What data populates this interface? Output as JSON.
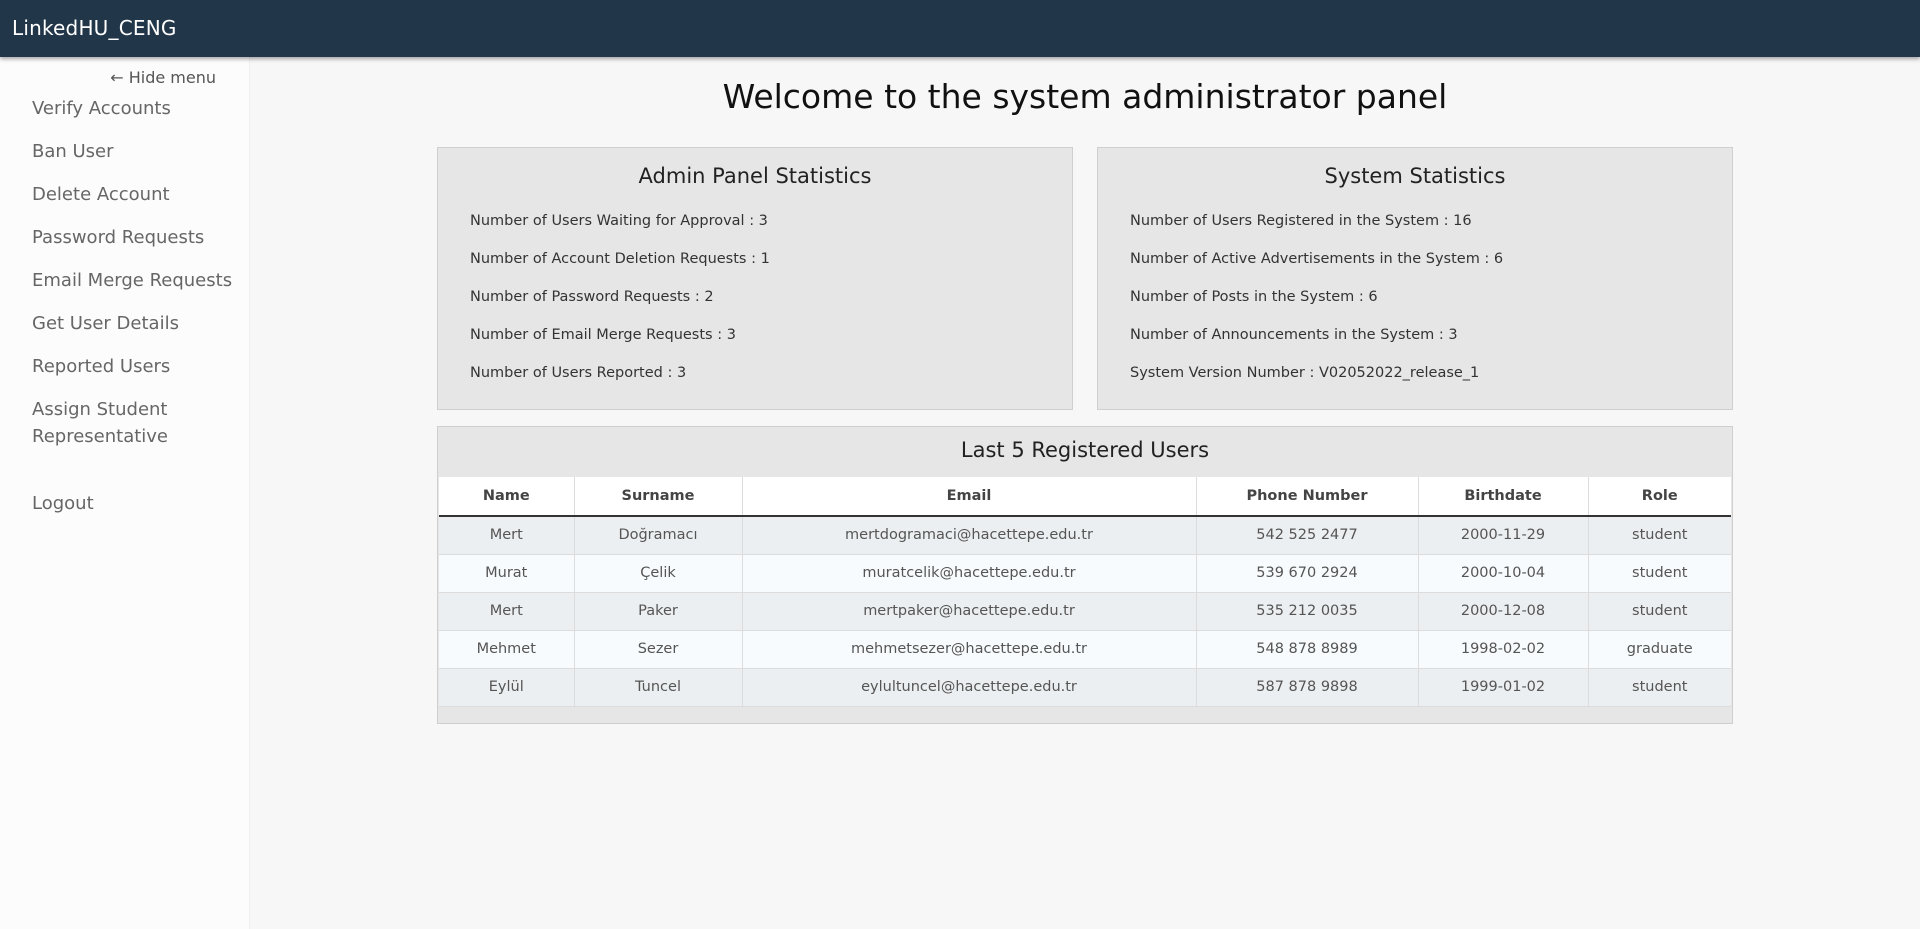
{
  "app": {
    "title": "LinkedHU_CENG"
  },
  "sidebar": {
    "hide_menu_label": "← Hide menu",
    "items": [
      {
        "label": "Verify Accounts"
      },
      {
        "label": "Ban User"
      },
      {
        "label": "Delete Account"
      },
      {
        "label": "Password Requests"
      },
      {
        "label": "Email Merge Requests"
      },
      {
        "label": "Get User Details"
      },
      {
        "label": "Reported Users"
      },
      {
        "label": "Assign Student Representative"
      }
    ],
    "logout_label": "Logout"
  },
  "main": {
    "welcome": "Welcome to the system administrator panel",
    "admin_stats": {
      "title": "Admin Panel Statistics",
      "lines": [
        "Number of Users Waiting for Approval : 3",
        "Number of Account Deletion Requests : 1",
        "Number of Password Requests : 2",
        "Number of Email Merge Requests : 3",
        "Number of Users Reported : 3"
      ]
    },
    "system_stats": {
      "title": "System Statistics",
      "lines": [
        "Number of Users Registered in the System : 16",
        "Number of Active Advertisements in the System : 6",
        "Number of Posts in the System : 6",
        "Number of Announcements in the System : 3",
        "System Version Number : V02052022_release_1"
      ]
    },
    "last_users": {
      "title": "Last 5 Registered Users",
      "headers": [
        "Name",
        "Surname",
        "Email",
        "Phone Number",
        "Birthdate",
        "Role"
      ],
      "rows": [
        [
          "Mert",
          "Doğramacı",
          "mertdogramaci@hacettepe.edu.tr",
          "542 525 2477",
          "2000-11-29",
          "student"
        ],
        [
          "Murat",
          "Çelik",
          "muratcelik@hacettepe.edu.tr",
          "539 670 2924",
          "2000-10-04",
          "student"
        ],
        [
          "Mert",
          "Paker",
          "mertpaker@hacettepe.edu.tr",
          "535 212 0035",
          "2000-12-08",
          "student"
        ],
        [
          "Mehmet",
          "Sezer",
          "mehmetsezer@hacettepe.edu.tr",
          "548 878 8989",
          "1998-02-02",
          "graduate"
        ],
        [
          "Eylül",
          "Tuncel",
          "eylultuncel@hacettepe.edu.tr",
          "587 878 9898",
          "1999-01-02",
          "student"
        ]
      ]
    }
  }
}
